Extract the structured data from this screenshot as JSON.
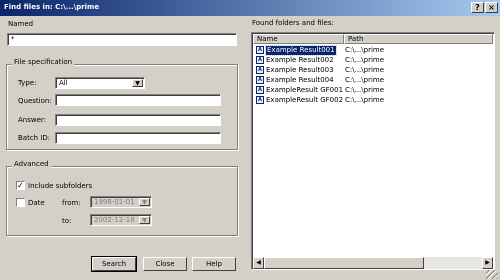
{
  "window": {
    "title": "Find files in: C:\\...\\prime"
  },
  "named": {
    "label": "Named",
    "value": "*"
  },
  "file_spec": {
    "group_label": "File specification",
    "type_label": "Type:",
    "type_value": "All",
    "question_label": "Question:",
    "answer_label": "Answer:",
    "batch_label": "Batch ID:"
  },
  "advanced": {
    "group_label": "Advanced",
    "include_subfolders_label": "Include subfolders",
    "include_subfolders_checked": true,
    "date_label": "Date",
    "date_checked": false,
    "from_label": "from:",
    "from_value": "1998-01-01",
    "to_label": "to:",
    "to_value": "2002-12-18"
  },
  "buttons": {
    "search": "Search",
    "close": "Close",
    "help": "Help"
  },
  "results": {
    "label": "Found folders and files:",
    "columns": {
      "name": "Name",
      "path": "Path"
    },
    "rows": [
      {
        "name": "Example Result001",
        "path": "C:\\...\\prime",
        "selected": true
      },
      {
        "name": "Example Result002",
        "path": "C:\\...\\prime",
        "selected": false
      },
      {
        "name": "Example Result003",
        "path": "C:\\...\\prime",
        "selected": false
      },
      {
        "name": "Example Result004",
        "path": "C:\\...\\prime",
        "selected": false
      },
      {
        "name": "ExampleResult GF001",
        "path": "C:\\...\\prime",
        "selected": false
      },
      {
        "name": "ExampleResult GF002",
        "path": "C:\\...\\prime",
        "selected": false
      }
    ]
  },
  "colors": {
    "selection": "#0a246a",
    "face": "#d4d0c8",
    "title_gradient_end": "#a6caf0"
  }
}
